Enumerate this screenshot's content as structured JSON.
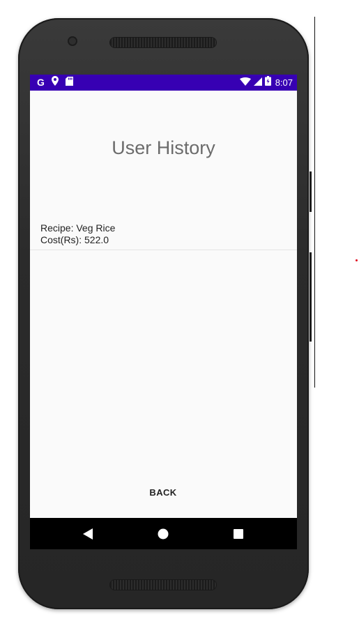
{
  "status_bar": {
    "google_letter": "G",
    "time": "8:07",
    "icons": [
      "google-icon",
      "location-pin-icon",
      "sd-card-icon",
      "wifi-icon",
      "cell-signal-icon",
      "battery-charging-icon"
    ],
    "background_color": "#3700b3"
  },
  "screen": {
    "title": "User History",
    "history": [
      {
        "recipe_line": "Recipe: Veg Rice",
        "cost_line": "Cost(Rs): 522.0"
      }
    ],
    "back_button_label": "BACK"
  },
  "nav_bar": {
    "icons": [
      "nav-back-icon",
      "nav-home-icon",
      "nav-recents-icon"
    ]
  }
}
